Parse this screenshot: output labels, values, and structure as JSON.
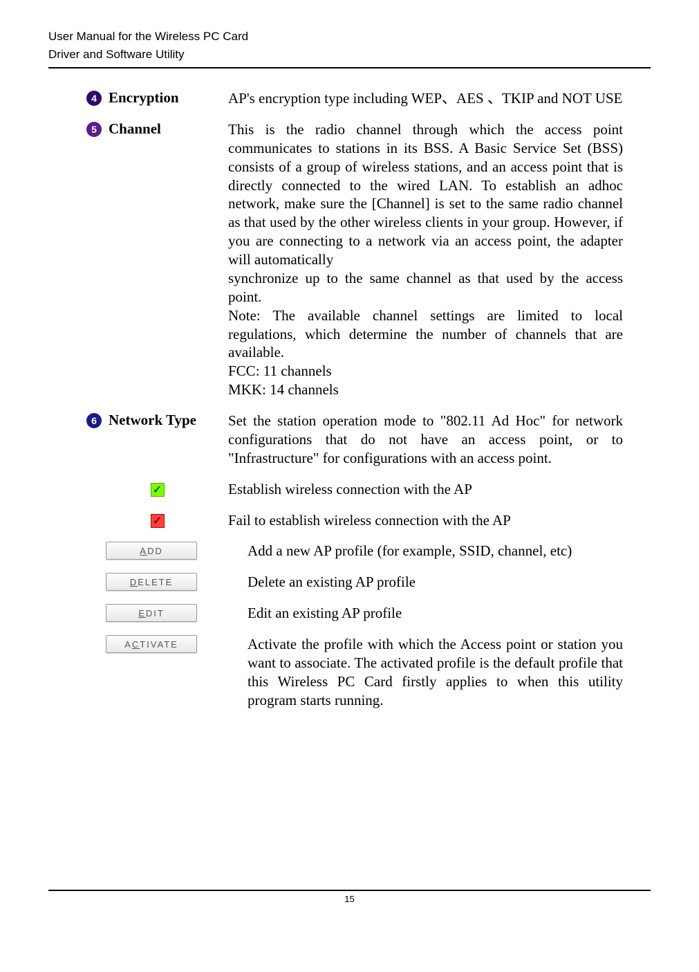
{
  "header": {
    "line1": "User Manual for the Wireless PC Card",
    "line2": "Driver and Software Utility"
  },
  "rows": {
    "encryption": {
      "num": "4",
      "label": "Encryption",
      "desc": "AP's encryption type including WEP、AES 、TKIP and NOT USE"
    },
    "channel": {
      "num": "5",
      "label": "Channel",
      "desc": "This is the radio channel through which the access point communicates to stations in its BSS. A Basic Service Set (BSS) consists of a group of wireless stations, and an access point that is directly connected to the wired LAN. To establish an adhoc network, make sure the [Channel] is set to the same radio channel as that used by the other wireless clients in your group. However, if you are connecting to a network via an access point, the adapter will automatically",
      "desc2": "synchronize up to the same channel as that used by the access point.",
      "note": "Note: The available channel settings are limited to local regulations, which determine the number of channels that are available.",
      "fcc": "FCC: 11 channels",
      "mkk": "MKK: 14 channels"
    },
    "networktype": {
      "num": "6",
      "label": "Network Type",
      "desc": "Set the station operation mode to \"802.11 Ad Hoc\" for network configurations that do not have an access point, or to \"Infrastructure\" for configurations with an access point."
    },
    "green_check": {
      "desc": "Establish wireless connection with the AP"
    },
    "red_check": {
      "desc": "Fail to establish wireless connection with the AP"
    },
    "add": {
      "label_pre": "",
      "label_ul": "A",
      "label_post": "DD",
      "desc": "Add a new AP profile (for example, SSID, channel, etc)"
    },
    "delete": {
      "label_pre": "",
      "label_ul": "D",
      "label_post": "ELETE",
      "desc": "Delete an existing AP profile"
    },
    "edit": {
      "label_pre": "",
      "label_ul": "E",
      "label_post": "DIT",
      "desc": "Edit an existing AP profile"
    },
    "activate": {
      "label_pre": "A",
      "label_ul": "C",
      "label_post": "TIVATE",
      "desc": "Activate the profile with which the Access point or station you want to associate. The activated profile is the default profile that this Wireless PC Card firstly applies to when this utility program starts running."
    }
  },
  "footer": {
    "page_number": "15"
  }
}
